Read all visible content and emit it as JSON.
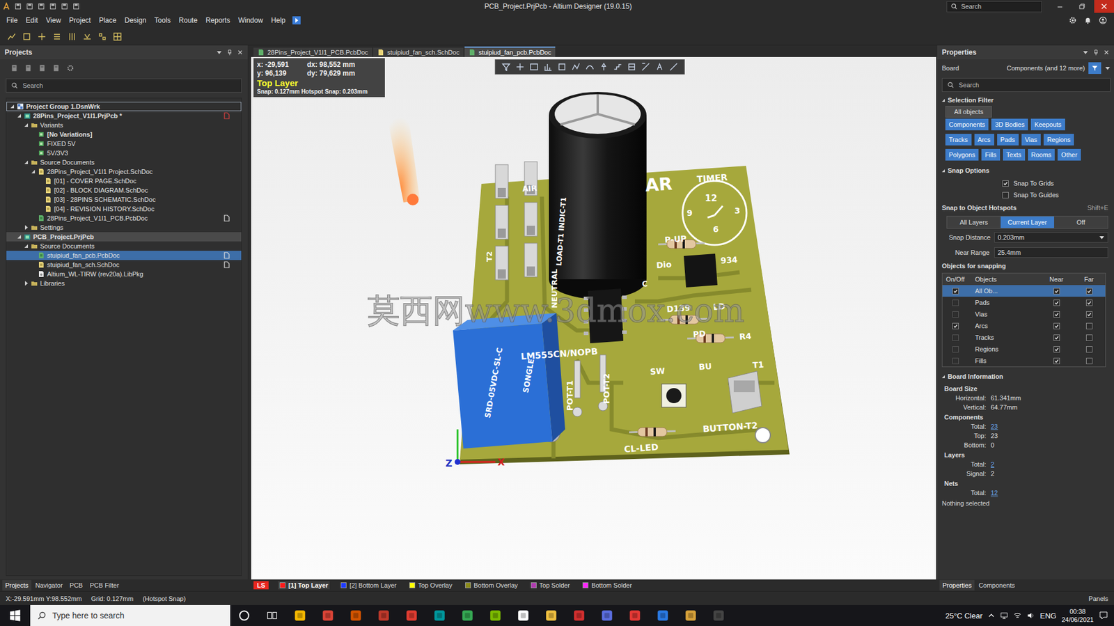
{
  "window": {
    "title": "PCB_Project.PrjPcb - Altium Designer (19.0.15)",
    "search": "Search"
  },
  "menu": [
    "File",
    "Edit",
    "View",
    "Project",
    "Place",
    "Design",
    "Tools",
    "Route",
    "Reports",
    "Window",
    "Help"
  ],
  "projects": {
    "title": "Projects",
    "search": "Search",
    "tree": [
      {
        "label": "Project Group 1.DsnWrk",
        "level": 0,
        "kind": "group",
        "toggle": "open",
        "highlight": "focus",
        "bold": true,
        "flag": "none"
      },
      {
        "label": "28Pins_Project_V1I1.PrjPcb *",
        "level": 1,
        "kind": "project",
        "toggle": "open",
        "highlight": "none",
        "bold": true,
        "flag": "modified"
      },
      {
        "label": "Variants",
        "level": 2,
        "kind": "folder",
        "toggle": "open",
        "highlight": "none",
        "bold": false,
        "flag": "none"
      },
      {
        "label": "[No Variations]",
        "level": 3,
        "kind": "variant",
        "toggle": "none",
        "highlight": "none",
        "bold": true,
        "flag": "none"
      },
      {
        "label": "FIXED 5V",
        "level": 3,
        "kind": "variant",
        "toggle": "none",
        "highlight": "none",
        "bold": false,
        "flag": "none"
      },
      {
        "label": "5V/3V3",
        "level": 3,
        "kind": "variant",
        "toggle": "none",
        "highlight": "none",
        "bold": false,
        "flag": "none"
      },
      {
        "label": "Source Documents",
        "level": 2,
        "kind": "folder",
        "toggle": "open",
        "highlight": "none",
        "bold": false,
        "flag": "none"
      },
      {
        "label": "28Pins_Project_V1I1 Project.SchDoc",
        "level": 3,
        "kind": "schdoc",
        "toggle": "open",
        "highlight": "none",
        "bold": false,
        "flag": "none"
      },
      {
        "label": "[01] - COVER PAGE.SchDoc",
        "level": 4,
        "kind": "schdoc",
        "toggle": "none",
        "highlight": "none",
        "bold": false,
        "flag": "none"
      },
      {
        "label": "[02] - BLOCK DIAGRAM.SchDoc",
        "level": 4,
        "kind": "schdoc",
        "toggle": "none",
        "highlight": "none",
        "bold": false,
        "flag": "none"
      },
      {
        "label": "[03] - 28PINS SCHEMATIC.SchDoc",
        "level": 4,
        "kind": "schdoc",
        "toggle": "none",
        "highlight": "none",
        "bold": false,
        "flag": "none"
      },
      {
        "label": "[04] - REVISION HISTORY.SchDoc",
        "level": 4,
        "kind": "schdoc",
        "toggle": "none",
        "highlight": "none",
        "bold": false,
        "flag": "none"
      },
      {
        "label": "28Pins_Project_V1I1_PCB.PcbDoc",
        "level": 3,
        "kind": "pcbdoc",
        "toggle": "none",
        "highlight": "none",
        "bold": false,
        "flag": "open"
      },
      {
        "label": "Settings",
        "level": 2,
        "kind": "folder",
        "toggle": "closed",
        "highlight": "none",
        "bold": false,
        "flag": "none"
      },
      {
        "label": "PCB_Project.PrjPcb",
        "level": 1,
        "kind": "project",
        "toggle": "open",
        "highlight": "active",
        "bold": true,
        "flag": "none"
      },
      {
        "label": "Source Documents",
        "level": 2,
        "kind": "folder",
        "toggle": "open",
        "highlight": "none",
        "bold": false,
        "flag": "none"
      },
      {
        "label": "stuipiud_fan_pcb.PcbDoc",
        "level": 3,
        "kind": "pcbdoc",
        "toggle": "none",
        "highlight": "selected",
        "bold": false,
        "flag": "open"
      },
      {
        "label": "stuipiud_fan_sch.SchDoc",
        "level": 3,
        "kind": "schdoc",
        "toggle": "none",
        "highlight": "none",
        "bold": false,
        "flag": "open"
      },
      {
        "label": "Altium_WL-TIRW (rev20a).LibPkg",
        "level": 3,
        "kind": "libpkg",
        "toggle": "none",
        "highlight": "none",
        "bold": false,
        "flag": "none"
      },
      {
        "label": "Libraries",
        "level": 2,
        "kind": "folder",
        "toggle": "closed",
        "highlight": "none",
        "bold": false,
        "flag": "none"
      }
    ],
    "tabs": [
      {
        "label": "Projects",
        "selected": true
      },
      {
        "label": "Navigator",
        "selected": false
      },
      {
        "label": "PCB",
        "selected": false
      },
      {
        "label": "PCB Filter",
        "selected": false
      }
    ]
  },
  "documents": [
    {
      "label": "28Pins_Project_V1I1_PCB.PcbDoc",
      "kind": "pcbdoc",
      "selected": false
    },
    {
      "label": "stuipiud_fan_sch.SchDoc",
      "kind": "schdoc",
      "selected": false
    },
    {
      "label": "stuipiud_fan_pcb.PcbDoc",
      "kind": "pcbdoc",
      "selected": true
    }
  ],
  "canvas": {
    "coords": [
      "x: -29,591",
      "dx: 98,552 mm",
      "y: 96,139",
      "dy: 79,629 mm"
    ],
    "layer": "Top Layer",
    "snap": "Snap: 0.127mm Hotspot Snap: 0.203mm"
  },
  "pcb": {
    "labels": [
      "AR",
      "TIMER",
      "12",
      "3",
      "6",
      "9",
      "P-UP",
      "Dio",
      "934",
      "D139",
      "LD",
      "PD",
      "R4",
      "LM555CN/NOPB",
      "SW",
      "BU",
      "T1",
      "BUTTON-T2",
      "CL-LED",
      "POT-T1",
      "POT-T2",
      "NEUTRAL",
      "LOAD-T1 INDIC-T1",
      "AIR",
      "C",
      "T2",
      "SRD-05VDC-SL-C",
      "SONGLE"
    ],
    "axes": [
      "Z",
      "X"
    ],
    "watermark": "莫西网www.3dmox.com"
  },
  "layers": [
    {
      "label": "LS",
      "kind": "set",
      "color": "#e8261f",
      "selected": false
    },
    {
      "label": "[1] Top Layer",
      "kind": "layer",
      "color": "#ff1a1a",
      "selected": true
    },
    {
      "label": "[2] Bottom Layer",
      "kind": "layer",
      "color": "#1f3cff",
      "selected": false
    },
    {
      "label": "Top Overlay",
      "kind": "layer",
      "color": "#ffff00",
      "selected": false
    },
    {
      "label": "Bottom Overlay",
      "kind": "layer",
      "color": "#8c8c1a",
      "selected": false
    },
    {
      "label": "Top Solder",
      "kind": "layer",
      "color": "#b03cb0",
      "selected": false
    },
    {
      "label": "Bottom Solder",
      "kind": "layer",
      "color": "#ff22ff",
      "selected": false
    }
  ],
  "properties": {
    "title": "Properties",
    "context": "Board",
    "filter": "Components (and 12 more)",
    "search": "Search",
    "selection_filter": {
      "title": "Selection Filter",
      "all": "All objects",
      "rows": [
        [
          {
            "label": "Components",
            "on": true
          },
          {
            "label": "3D Bodies",
            "on": true
          },
          {
            "label": "Keepouts",
            "on": true
          }
        ],
        [
          {
            "label": "Tracks",
            "on": true
          },
          {
            "label": "Arcs",
            "on": true
          },
          {
            "label": "Pads",
            "on": true
          },
          {
            "label": "Vias",
            "on": true
          },
          {
            "label": "Regions",
            "on": true
          }
        ],
        [
          {
            "label": "Polygons",
            "on": true
          },
          {
            "label": "Fills",
            "on": true
          },
          {
            "label": "Texts",
            "on": true
          },
          {
            "label": "Rooms",
            "on": true
          },
          {
            "label": "Other",
            "on": true
          }
        ]
      ]
    },
    "snap_options": {
      "title": "Snap Options",
      "checks": [
        {
          "label": "Snap To Grids",
          "checked": true
        },
        {
          "label": "Snap To Guides",
          "checked": false
        }
      ],
      "hotspots_title": "Snap to Object Hotspots",
      "shortcut": "Shift+E",
      "modes": [
        {
          "label": "All Layers",
          "selected": false
        },
        {
          "label": "Current Layer",
          "selected": true
        },
        {
          "label": "Off",
          "selected": false
        }
      ],
      "fields": [
        {
          "label": "Snap Distance",
          "value": "0.203mm",
          "kind": "dropdown"
        },
        {
          "label": "Near Range",
          "value": "25.4mm",
          "kind": "text"
        }
      ],
      "objects_title": "Objects for snapping",
      "columns": [
        "On/Off",
        "Objects",
        "Near",
        "Far"
      ],
      "rows": [
        {
          "label": "All Ob...",
          "on": true,
          "near": true,
          "far": true,
          "selected": true
        },
        {
          "label": "Pads",
          "on": false,
          "near": true,
          "far": true,
          "selected": false
        },
        {
          "label": "Vias",
          "on": false,
          "near": true,
          "far": true,
          "selected": false
        },
        {
          "label": "Arcs",
          "on": true,
          "near": true,
          "far": false,
          "selected": false
        },
        {
          "label": "Tracks",
          "on": false,
          "near": true,
          "far": false,
          "selected": false
        },
        {
          "label": "Regions",
          "on": false,
          "near": true,
          "far": false,
          "selected": false
        },
        {
          "label": "Fills",
          "on": false,
          "near": true,
          "far": false,
          "selected": false
        }
      ]
    },
    "board_info": {
      "title": "Board Information",
      "groups": [
        {
          "title": "Board Size",
          "rows": [
            {
              "label": "Horizontal:",
              "value": "61.341mm",
              "link": false
            },
            {
              "label": "Vertical:",
              "value": "64.77mm",
              "link": false
            }
          ]
        },
        {
          "title": "Components",
          "rows": [
            {
              "label": "Total:",
              "value": "23",
              "link": true
            },
            {
              "label": "Top:",
              "value": "23",
              "link": false
            },
            {
              "label": "Bottom:",
              "value": "0",
              "link": false
            }
          ]
        },
        {
          "title": "Layers",
          "rows": [
            {
              "label": "Total:",
              "value": "2",
              "link": true
            },
            {
              "label": "Signal:",
              "value": "2",
              "link": false
            }
          ]
        },
        {
          "title": "Nets",
          "rows": [
            {
              "label": "Total:",
              "value": "12",
              "link": true
            }
          ]
        }
      ]
    },
    "status": "Nothing selected",
    "tabs": [
      {
        "label": "Properties",
        "selected": true
      },
      {
        "label": "Components",
        "selected": false
      }
    ]
  },
  "status_bar": {
    "items": [
      "X:-29.591mm Y:98.552mm",
      "Grid: 0.127mm",
      "(Hotspot Snap)"
    ],
    "panels": "Panels"
  },
  "taskbar": {
    "search": "Type here to search",
    "weather": "25°C Clear",
    "lang": "ENG",
    "time": "00:38",
    "date": "24/06/2021"
  }
}
